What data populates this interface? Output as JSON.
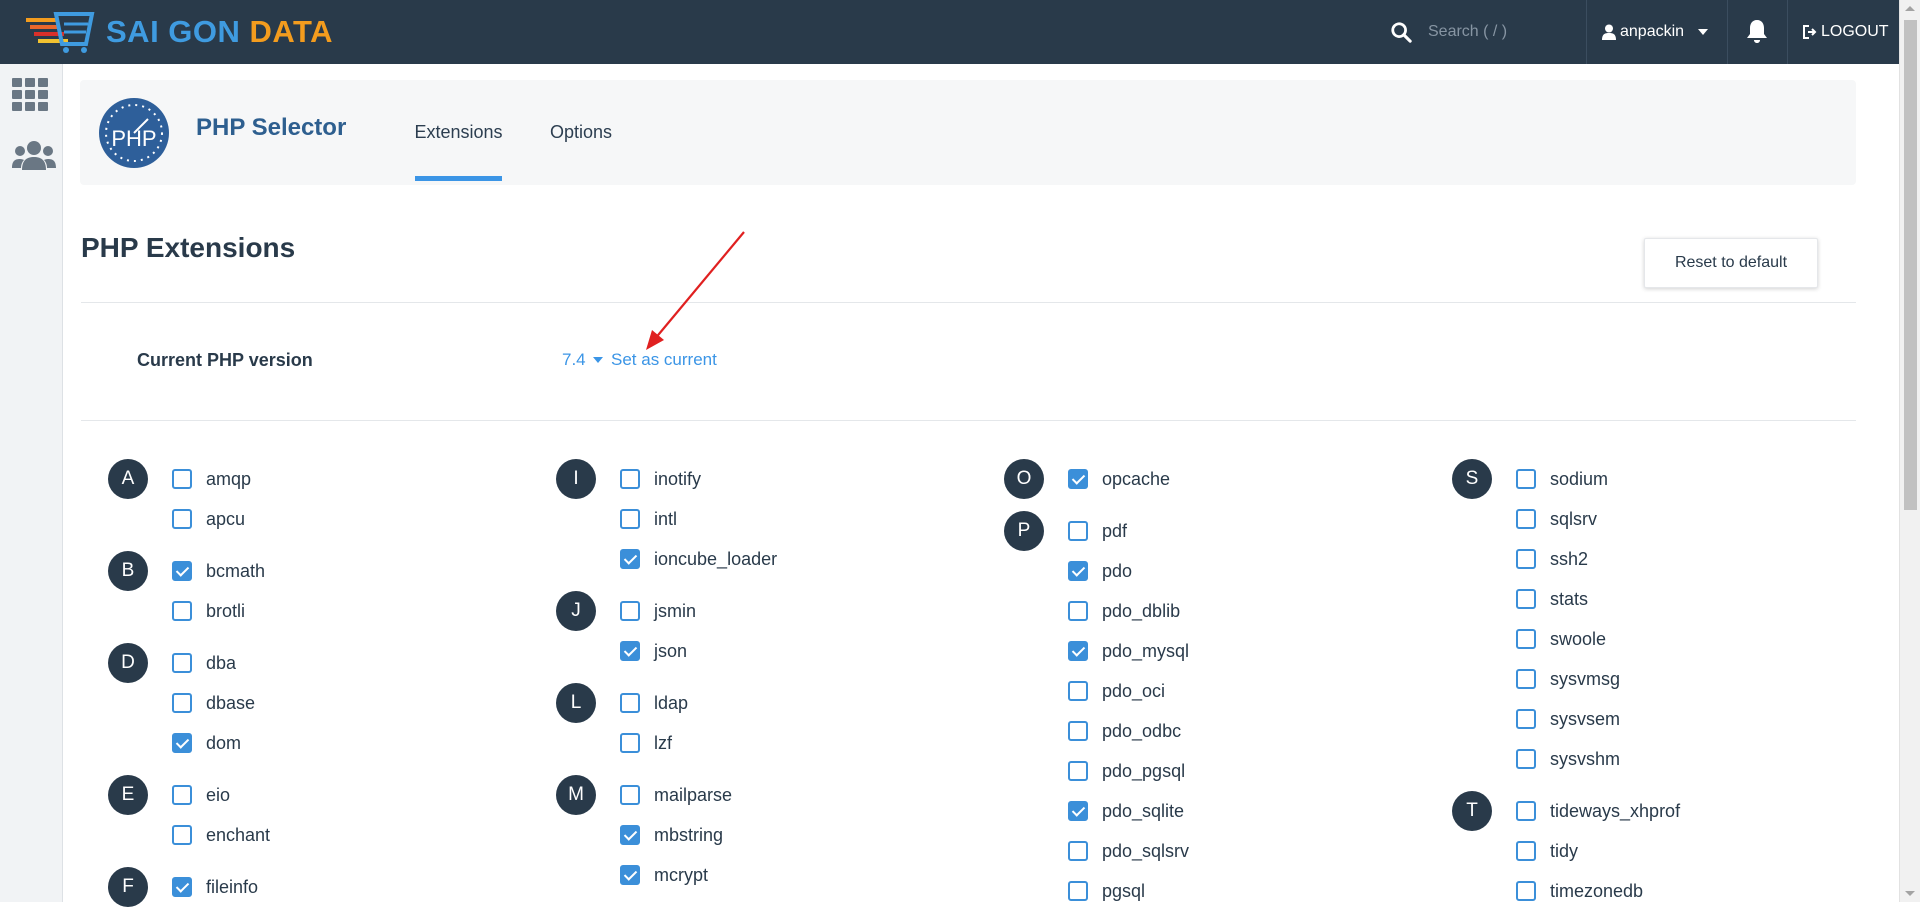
{
  "topbar": {
    "logo_word1": "SAI GON",
    "logo_word2": "DATA",
    "search_placeholder": "Search ( / )",
    "username": "anpackin",
    "logout_label": "LOGOUT"
  },
  "app": {
    "title": "PHP Selector",
    "tabs": [
      {
        "label": "Extensions",
        "active": true
      },
      {
        "label": "Options",
        "active": false
      }
    ],
    "logo_text": "PHP"
  },
  "section": {
    "title": "PHP Extensions",
    "reset_label": "Reset to default",
    "version_label": "Current PHP version",
    "version_value": "7.4",
    "set_current_label": "Set as current"
  },
  "colors": {
    "topbar": "#293a4a",
    "accent": "#3b95e6",
    "checkbox": "#3b8fd9",
    "annotation_arrow": "#e02020"
  },
  "extensions": [
    {
      "letter": "A",
      "name": "amqp",
      "checked": false
    },
    {
      "letter": "",
      "name": "apcu",
      "checked": false
    },
    {
      "letter": "B",
      "name": "bcmath",
      "checked": true
    },
    {
      "letter": "",
      "name": "brotli",
      "checked": false
    },
    {
      "letter": "D",
      "name": "dba",
      "checked": false
    },
    {
      "letter": "",
      "name": "dbase",
      "checked": false
    },
    {
      "letter": "",
      "name": "dom",
      "checked": true
    },
    {
      "letter": "E",
      "name": "eio",
      "checked": false
    },
    {
      "letter": "",
      "name": "enchant",
      "checked": false
    },
    {
      "letter": "F",
      "name": "fileinfo",
      "checked": true
    },
    {
      "letter": "I",
      "name": "inotify",
      "checked": false
    },
    {
      "letter": "",
      "name": "intl",
      "checked": false
    },
    {
      "letter": "",
      "name": "ioncube_loader",
      "checked": true
    },
    {
      "letter": "J",
      "name": "jsmin",
      "checked": false
    },
    {
      "letter": "",
      "name": "json",
      "checked": true
    },
    {
      "letter": "L",
      "name": "ldap",
      "checked": false
    },
    {
      "letter": "",
      "name": "lzf",
      "checked": false
    },
    {
      "letter": "M",
      "name": "mailparse",
      "checked": false
    },
    {
      "letter": "",
      "name": "mbstring",
      "checked": true
    },
    {
      "letter": "",
      "name": "mcrypt",
      "checked": true
    },
    {
      "letter": "O",
      "name": "opcache",
      "checked": true
    },
    {
      "letter": "P",
      "name": "pdf",
      "checked": false
    },
    {
      "letter": "",
      "name": "pdo",
      "checked": true
    },
    {
      "letter": "",
      "name": "pdo_dblib",
      "checked": false
    },
    {
      "letter": "",
      "name": "pdo_mysql",
      "checked": true
    },
    {
      "letter": "",
      "name": "pdo_oci",
      "checked": false
    },
    {
      "letter": "",
      "name": "pdo_odbc",
      "checked": false
    },
    {
      "letter": "",
      "name": "pdo_pgsql",
      "checked": false
    },
    {
      "letter": "",
      "name": "pdo_sqlite",
      "checked": true
    },
    {
      "letter": "",
      "name": "pdo_sqlsrv",
      "checked": false
    },
    {
      "letter": "",
      "name": "pgsql",
      "checked": false
    },
    {
      "letter": "S",
      "name": "sodium",
      "checked": false
    },
    {
      "letter": "",
      "name": "sqlsrv",
      "checked": false
    },
    {
      "letter": "",
      "name": "ssh2",
      "checked": false
    },
    {
      "letter": "",
      "name": "stats",
      "checked": false
    },
    {
      "letter": "",
      "name": "swoole",
      "checked": false
    },
    {
      "letter": "",
      "name": "sysvmsg",
      "checked": false
    },
    {
      "letter": "",
      "name": "sysvsem",
      "checked": false
    },
    {
      "letter": "",
      "name": "sysvshm",
      "checked": false
    },
    {
      "letter": "T",
      "name": "tideways_xhprof",
      "checked": false
    },
    {
      "letter": "",
      "name": "tidy",
      "checked": false
    },
    {
      "letter": "",
      "name": "timezonedb",
      "checked": false
    }
  ]
}
